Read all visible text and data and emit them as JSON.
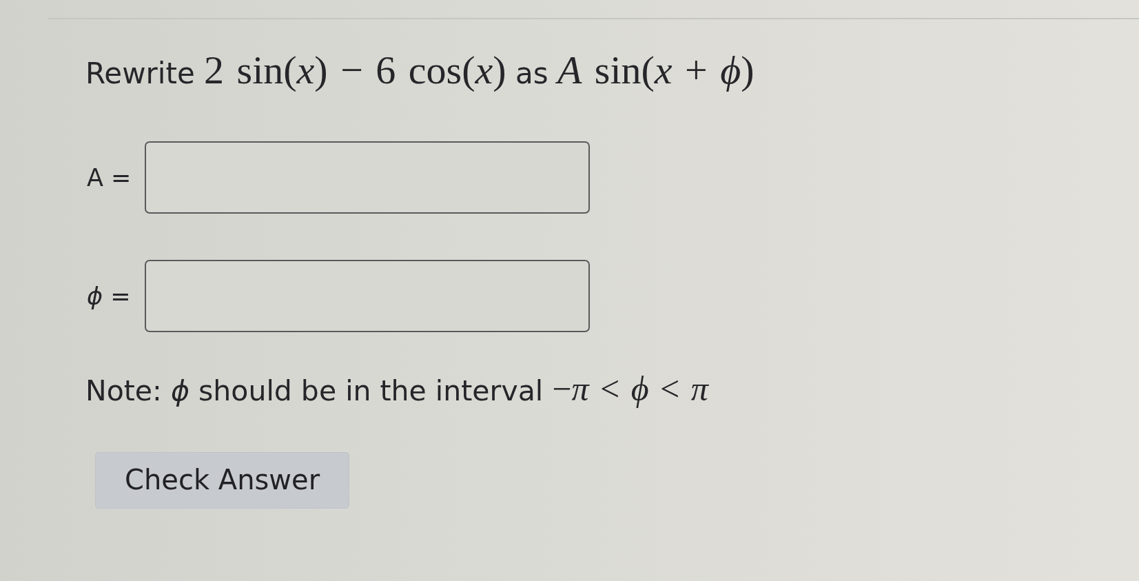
{
  "question": {
    "parts": [
      {
        "kind": "text",
        "text": "Rewrite"
      },
      {
        "kind": "math",
        "text": "2 sin(*x*) − 6 cos(*x*)"
      },
      {
        "kind": "text",
        "text": "as"
      },
      {
        "kind": "math",
        "text": "*A* sin(*x* + *ϕ*)"
      }
    ]
  },
  "fields": [
    {
      "label": "A ="
    },
    {
      "label": "*ϕ* ="
    }
  ],
  "note": {
    "parts": [
      {
        "kind": "text",
        "text": "Note: *ϕ* should be in the interval"
      },
      {
        "kind": "math",
        "text": "−*π* < *ϕ* < *π*"
      }
    ]
  },
  "button": {
    "label": "Check Answer"
  }
}
